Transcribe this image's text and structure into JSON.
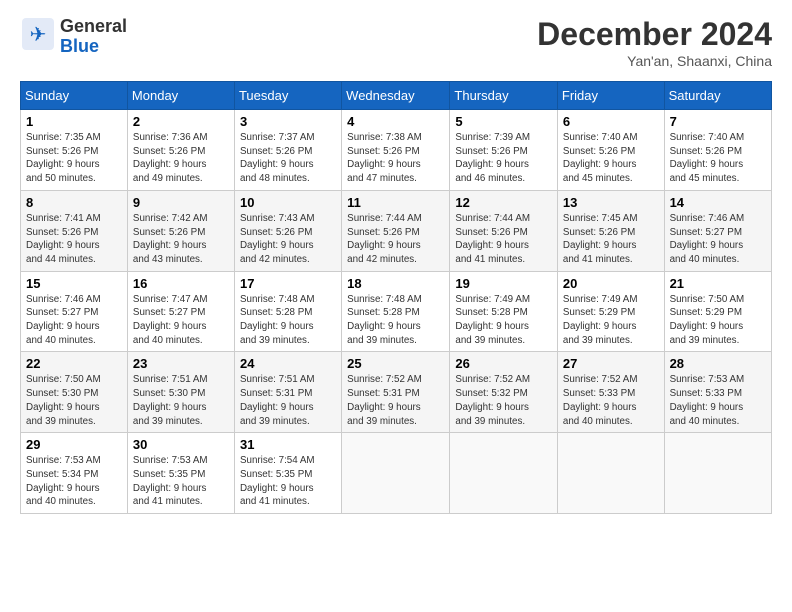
{
  "logo": {
    "line1": "General",
    "line2": "Blue"
  },
  "title": "December 2024",
  "subtitle": "Yan'an, Shaanxi, China",
  "weekdays": [
    "Sunday",
    "Monday",
    "Tuesday",
    "Wednesday",
    "Thursday",
    "Friday",
    "Saturday"
  ],
  "weeks": [
    [
      {
        "day": "1",
        "sunrise": "7:35 AM",
        "sunset": "5:26 PM",
        "daylight": "9 hours and 50 minutes."
      },
      {
        "day": "2",
        "sunrise": "7:36 AM",
        "sunset": "5:26 PM",
        "daylight": "9 hours and 49 minutes."
      },
      {
        "day": "3",
        "sunrise": "7:37 AM",
        "sunset": "5:26 PM",
        "daylight": "9 hours and 48 minutes."
      },
      {
        "day": "4",
        "sunrise": "7:38 AM",
        "sunset": "5:26 PM",
        "daylight": "9 hours and 47 minutes."
      },
      {
        "day": "5",
        "sunrise": "7:39 AM",
        "sunset": "5:26 PM",
        "daylight": "9 hours and 46 minutes."
      },
      {
        "day": "6",
        "sunrise": "7:40 AM",
        "sunset": "5:26 PM",
        "daylight": "9 hours and 45 minutes."
      },
      {
        "day": "7",
        "sunrise": "7:40 AM",
        "sunset": "5:26 PM",
        "daylight": "9 hours and 45 minutes."
      }
    ],
    [
      {
        "day": "8",
        "sunrise": "7:41 AM",
        "sunset": "5:26 PM",
        "daylight": "9 hours and 44 minutes."
      },
      {
        "day": "9",
        "sunrise": "7:42 AM",
        "sunset": "5:26 PM",
        "daylight": "9 hours and 43 minutes."
      },
      {
        "day": "10",
        "sunrise": "7:43 AM",
        "sunset": "5:26 PM",
        "daylight": "9 hours and 42 minutes."
      },
      {
        "day": "11",
        "sunrise": "7:44 AM",
        "sunset": "5:26 PM",
        "daylight": "9 hours and 42 minutes."
      },
      {
        "day": "12",
        "sunrise": "7:44 AM",
        "sunset": "5:26 PM",
        "daylight": "9 hours and 41 minutes."
      },
      {
        "day": "13",
        "sunrise": "7:45 AM",
        "sunset": "5:26 PM",
        "daylight": "9 hours and 41 minutes."
      },
      {
        "day": "14",
        "sunrise": "7:46 AM",
        "sunset": "5:27 PM",
        "daylight": "9 hours and 40 minutes."
      }
    ],
    [
      {
        "day": "15",
        "sunrise": "7:46 AM",
        "sunset": "5:27 PM",
        "daylight": "9 hours and 40 minutes."
      },
      {
        "day": "16",
        "sunrise": "7:47 AM",
        "sunset": "5:27 PM",
        "daylight": "9 hours and 40 minutes."
      },
      {
        "day": "17",
        "sunrise": "7:48 AM",
        "sunset": "5:28 PM",
        "daylight": "9 hours and 39 minutes."
      },
      {
        "day": "18",
        "sunrise": "7:48 AM",
        "sunset": "5:28 PM",
        "daylight": "9 hours and 39 minutes."
      },
      {
        "day": "19",
        "sunrise": "7:49 AM",
        "sunset": "5:28 PM",
        "daylight": "9 hours and 39 minutes."
      },
      {
        "day": "20",
        "sunrise": "7:49 AM",
        "sunset": "5:29 PM",
        "daylight": "9 hours and 39 minutes."
      },
      {
        "day": "21",
        "sunrise": "7:50 AM",
        "sunset": "5:29 PM",
        "daylight": "9 hours and 39 minutes."
      }
    ],
    [
      {
        "day": "22",
        "sunrise": "7:50 AM",
        "sunset": "5:30 PM",
        "daylight": "9 hours and 39 minutes."
      },
      {
        "day": "23",
        "sunrise": "7:51 AM",
        "sunset": "5:30 PM",
        "daylight": "9 hours and 39 minutes."
      },
      {
        "day": "24",
        "sunrise": "7:51 AM",
        "sunset": "5:31 PM",
        "daylight": "9 hours and 39 minutes."
      },
      {
        "day": "25",
        "sunrise": "7:52 AM",
        "sunset": "5:31 PM",
        "daylight": "9 hours and 39 minutes."
      },
      {
        "day": "26",
        "sunrise": "7:52 AM",
        "sunset": "5:32 PM",
        "daylight": "9 hours and 39 minutes."
      },
      {
        "day": "27",
        "sunrise": "7:52 AM",
        "sunset": "5:33 PM",
        "daylight": "9 hours and 40 minutes."
      },
      {
        "day": "28",
        "sunrise": "7:53 AM",
        "sunset": "5:33 PM",
        "daylight": "9 hours and 40 minutes."
      }
    ],
    [
      {
        "day": "29",
        "sunrise": "7:53 AM",
        "sunset": "5:34 PM",
        "daylight": "9 hours and 40 minutes."
      },
      {
        "day": "30",
        "sunrise": "7:53 AM",
        "sunset": "5:35 PM",
        "daylight": "9 hours and 41 minutes."
      },
      {
        "day": "31",
        "sunrise": "7:54 AM",
        "sunset": "5:35 PM",
        "daylight": "9 hours and 41 minutes."
      },
      null,
      null,
      null,
      null
    ]
  ]
}
